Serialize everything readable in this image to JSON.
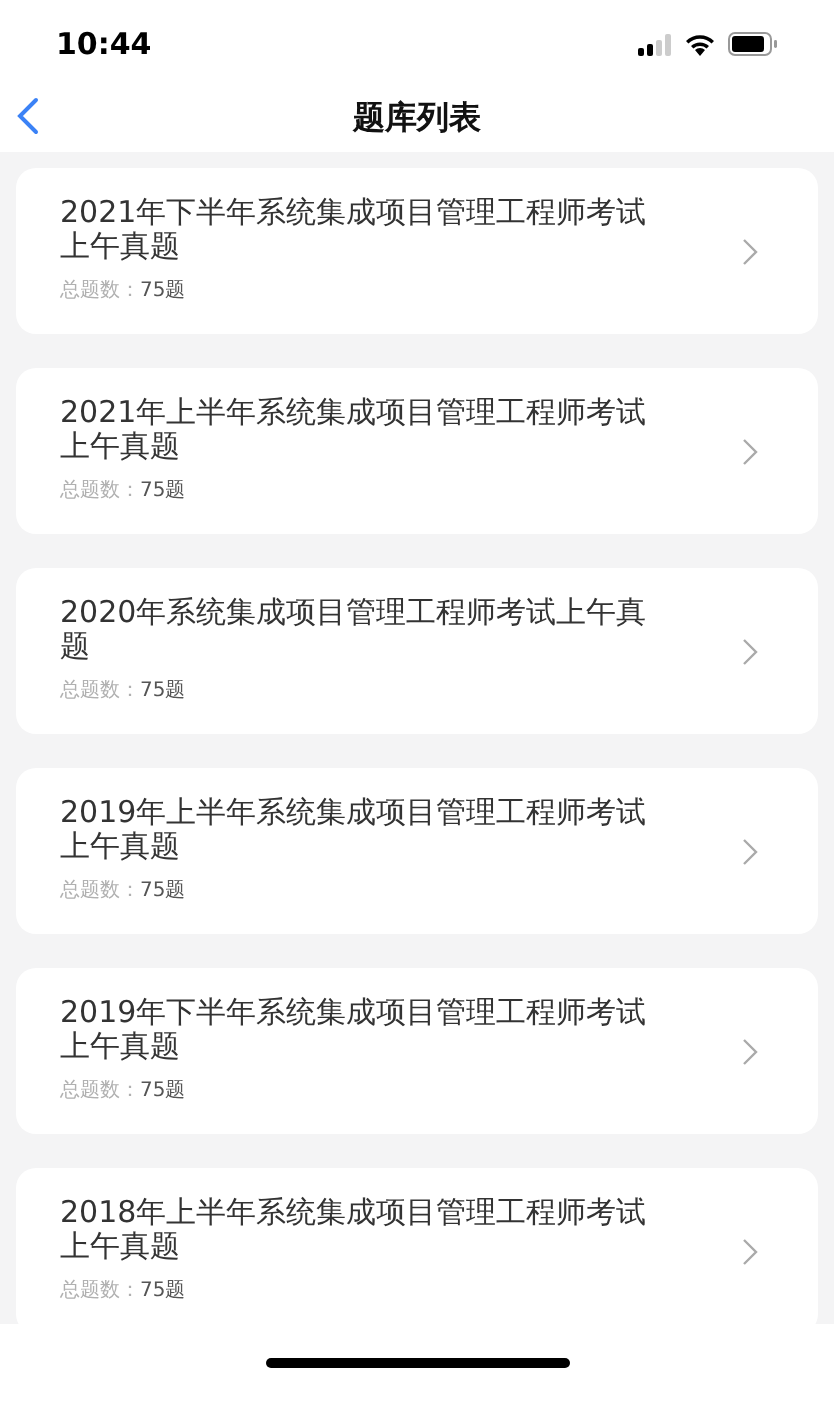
{
  "status_bar": {
    "time": "10:44"
  },
  "nav": {
    "title": "题库列表"
  },
  "items": [
    {
      "title": "2021年下半年系统集成项目管理工程师考试上午真题",
      "count_label": "总题数：",
      "count": "75题"
    },
    {
      "title": "2021年上半年系统集成项目管理工程师考试上午真题",
      "count_label": "总题数：",
      "count": "75题"
    },
    {
      "title": "2020年系统集成项目管理工程师考试上午真题",
      "count_label": "总题数：",
      "count": "75题"
    },
    {
      "title": "2019年上半年系统集成项目管理工程师考试上午真题",
      "count_label": "总题数：",
      "count": "75题"
    },
    {
      "title": "2019年下半年系统集成项目管理工程师考试上午真题",
      "count_label": "总题数：",
      "count": "75题"
    },
    {
      "title": "2018年上半年系统集成项目管理工程师考试上午真题",
      "count_label": "总题数：",
      "count": "75题"
    }
  ]
}
